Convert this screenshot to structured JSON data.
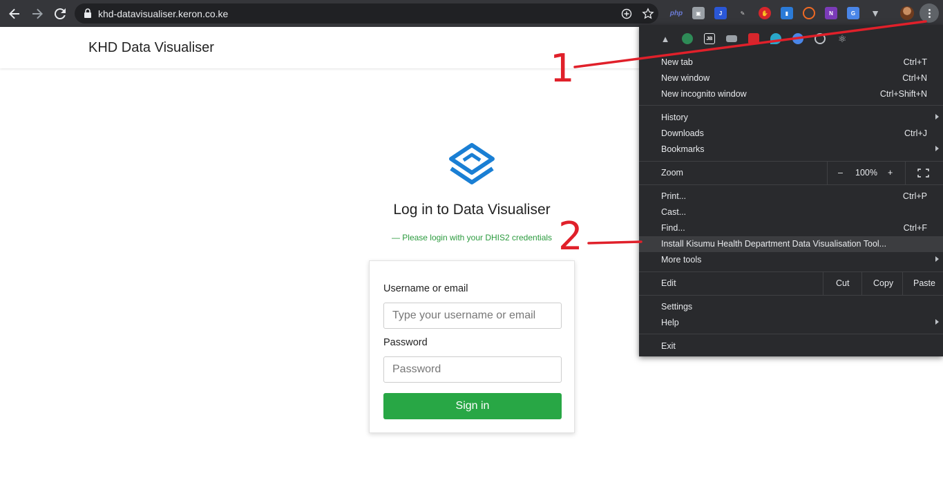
{
  "browser": {
    "url": "khd-datavisualiser.keron.co.ke",
    "extensions": [
      "php-icon",
      "camera-icon",
      "blue-j-icon",
      "pen-icon",
      "red-hand-icon",
      "bookmark-icon",
      "swirl-icon",
      "onenote-icon",
      "translate-icon",
      "v-icon"
    ],
    "profile_avatar": "avatar"
  },
  "header": {
    "brand": "KHD Data Visualiser"
  },
  "login": {
    "title": "Log in to Data Visualiser",
    "subtitle": "— Please login with your DHIS2 credentials",
    "username_label": "Username or email",
    "username_placeholder": "Type your username or email",
    "password_label": "Password",
    "password_placeholder": "Password",
    "signin_label": "Sign in"
  },
  "menu": {
    "new_tab": {
      "label": "New tab",
      "shortcut": "Ctrl+T"
    },
    "new_window": {
      "label": "New window",
      "shortcut": "Ctrl+N"
    },
    "new_incognito": {
      "label": "New incognito window",
      "shortcut": "Ctrl+Shift+N"
    },
    "history": {
      "label": "History"
    },
    "downloads": {
      "label": "Downloads",
      "shortcut": "Ctrl+J"
    },
    "bookmarks": {
      "label": "Bookmarks"
    },
    "zoom": {
      "label": "Zoom",
      "minus": "–",
      "value": "100%",
      "plus": "+"
    },
    "print": {
      "label": "Print...",
      "shortcut": "Ctrl+P"
    },
    "cast": {
      "label": "Cast..."
    },
    "find": {
      "label": "Find...",
      "shortcut": "Ctrl+F"
    },
    "install": {
      "label": "Install Kisumu Health Department Data Visualisation Tool..."
    },
    "more_tools": {
      "label": "More tools"
    },
    "edit": {
      "label": "Edit",
      "cut": "Cut",
      "copy": "Copy",
      "paste": "Paste"
    },
    "settings": {
      "label": "Settings"
    },
    "help": {
      "label": "Help"
    },
    "exit": {
      "label": "Exit"
    }
  },
  "annotations": {
    "step1": "1",
    "step2": "2",
    "color": "#e0202a"
  },
  "colors": {
    "accent_green": "#28a745",
    "logo_blue": "#1a7fd4",
    "toolbar": "#35363a",
    "menu_bg": "#292a2d"
  }
}
